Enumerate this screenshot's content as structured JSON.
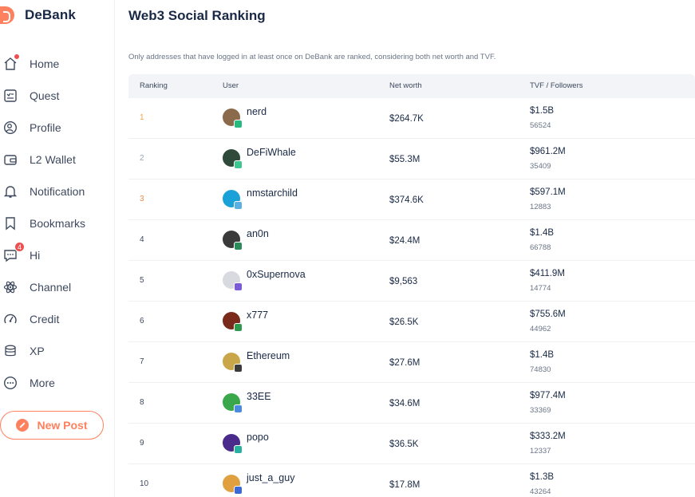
{
  "app": {
    "name": "DeBank"
  },
  "sidebar": {
    "items": [
      {
        "label": "Home",
        "icon": "home-icon"
      },
      {
        "label": "Quest",
        "icon": "quest-icon"
      },
      {
        "label": "Profile",
        "icon": "profile-icon"
      },
      {
        "label": "L2 Wallet",
        "icon": "wallet-icon"
      },
      {
        "label": "Notification",
        "icon": "bell-icon"
      },
      {
        "label": "Bookmarks",
        "icon": "bookmark-icon"
      },
      {
        "label": "Hi",
        "icon": "chat-icon",
        "badge": "4"
      },
      {
        "label": "Channel",
        "icon": "atom-icon"
      },
      {
        "label": "Credit",
        "icon": "gauge-icon"
      },
      {
        "label": "XP",
        "icon": "coins-icon"
      },
      {
        "label": "More",
        "icon": "more-icon"
      }
    ],
    "new_post_label": "New Post"
  },
  "main": {
    "title": "Web3 Social Ranking",
    "subtitle": "Only addresses that have logged in at least once on DeBank are ranked, considering both net worth and TVF.",
    "columns": [
      "Ranking",
      "User",
      "Net worth",
      "TVF / Followers"
    ],
    "rows": [
      {
        "rank": "1",
        "user": "nerd",
        "net_worth": "$264.7K",
        "tvf": "$1.5B",
        "followers": "56524",
        "avatar_color": "#8a6a4a",
        "badge_color": "#28b97e"
      },
      {
        "rank": "2",
        "user": "DeFiWhale",
        "net_worth": "$55.3M",
        "tvf": "$961.2M",
        "followers": "35409",
        "avatar_color": "#2f4a3a",
        "badge_color": "#3fc58f"
      },
      {
        "rank": "3",
        "user": "nmstarchild",
        "net_worth": "$374.6K",
        "tvf": "$597.1M",
        "followers": "12883",
        "avatar_color": "#1aa2d8",
        "badge_color": "#5ab0e0"
      },
      {
        "rank": "4",
        "user": "an0n",
        "net_worth": "$24.4M",
        "tvf": "$1.4B",
        "followers": "66788",
        "avatar_color": "#3a3a3a",
        "badge_color": "#2a8a5a"
      },
      {
        "rank": "5",
        "user": "0xSupernova",
        "net_worth": "$9,563",
        "tvf": "$411.9M",
        "followers": "14774",
        "avatar_color": "#d9d9e0",
        "badge_color": "#7a5bd8"
      },
      {
        "rank": "6",
        "user": "x777",
        "net_worth": "$26.5K",
        "tvf": "$755.6M",
        "followers": "44962",
        "avatar_color": "#7a2a1a",
        "badge_color": "#2e9a4e"
      },
      {
        "rank": "7",
        "user": "Ethereum",
        "net_worth": "$27.6M",
        "tvf": "$1.4B",
        "followers": "74830",
        "avatar_color": "#c9a64a",
        "badge_color": "#3a3a3a"
      },
      {
        "rank": "8",
        "user": "33EE",
        "net_worth": "$34.6M",
        "tvf": "$977.4M",
        "followers": "33369",
        "avatar_color": "#3aa84a",
        "badge_color": "#4a8ae0"
      },
      {
        "rank": "9",
        "user": "popo",
        "net_worth": "$36.5K",
        "tvf": "$333.2M",
        "followers": "12337",
        "avatar_color": "#4a2a8a",
        "badge_color": "#2ab0a0"
      },
      {
        "rank": "10",
        "user": "just_a_guy",
        "net_worth": "$17.8M",
        "tvf": "$1.3B",
        "followers": "43264",
        "avatar_color": "#e0a040",
        "badge_color": "#3a6ad8"
      }
    ]
  },
  "colors": {
    "accent": "#fe815f",
    "rank_1": "#f0a53e",
    "rank_2": "#9aa3b2",
    "rank_3": "#ea8a4a",
    "badge": "#ec5151"
  }
}
